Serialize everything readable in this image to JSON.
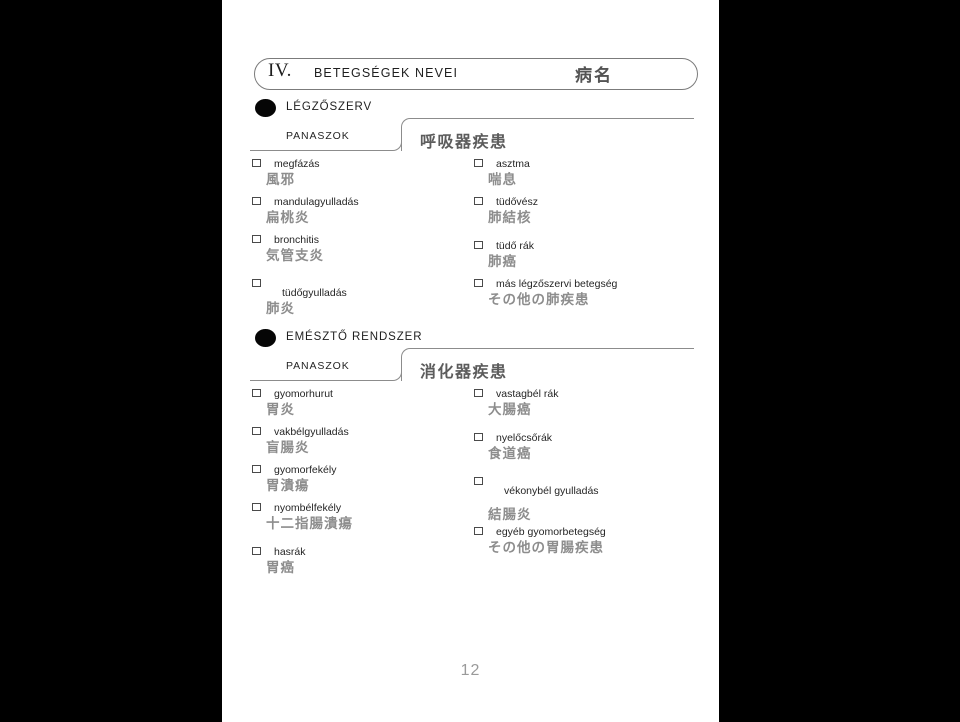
{
  "page": {
    "number": "12",
    "header": {
      "roman": "IV.",
      "title_hu": "BETEGSÉGEK NEVEI",
      "title_jp": "病名"
    }
  },
  "sections": [
    {
      "id": "respiratory",
      "dot": "section-bullet",
      "title_hu": "LÉGZŐSZERV",
      "tab_label": "PANASZOK",
      "tab_jp": "呼吸器疾患",
      "left_items": [
        {
          "hu": "megfázás",
          "jp": "風邪"
        },
        {
          "hu": "mandulagyulladás",
          "jp": "扁桃炎"
        },
        {
          "hu": "bronchitis",
          "jp": "気管支炎"
        },
        {
          "hu": "tüdőgyulladás",
          "jp": "肺炎"
        }
      ],
      "right_items": [
        {
          "hu": "asztma",
          "jp": "喘息"
        },
        {
          "hu": "tüdővész",
          "jp": "肺結核"
        },
        {
          "hu": "tüdő rák",
          "jp": "肺癌"
        },
        {
          "hu": "más légzőszervi betegség",
          "jp": "その他の肺疾患"
        }
      ]
    },
    {
      "id": "digestive",
      "dot": "section-bullet",
      "title_hu": "EMÉSZTŐ RENDSZER",
      "tab_label": "PANASZOK",
      "tab_jp": "消化器疾患",
      "left_items": [
        {
          "hu": "gyomorhurut",
          "jp": "胃炎"
        },
        {
          "hu": "vakbélgyulladás",
          "jp": "盲腸炎"
        },
        {
          "hu": "gyomorfekély",
          "jp": "胃潰瘍"
        },
        {
          "hu": "nyombélfekély",
          "jp": "十二指腸潰瘍"
        },
        {
          "hu": "hasrák",
          "jp": "胃癌"
        }
      ],
      "right_items": [
        {
          "hu": "vastagbél rák",
          "jp": "大腸癌"
        },
        {
          "hu": "nyelőcsőrák",
          "jp": "食道癌"
        },
        {
          "hu": "vékonybél gyulladás",
          "jp": "結腸炎"
        },
        {
          "hu": "egyéb gyomorbetegség",
          "jp": "その他の胃腸疾患"
        }
      ]
    }
  ]
}
